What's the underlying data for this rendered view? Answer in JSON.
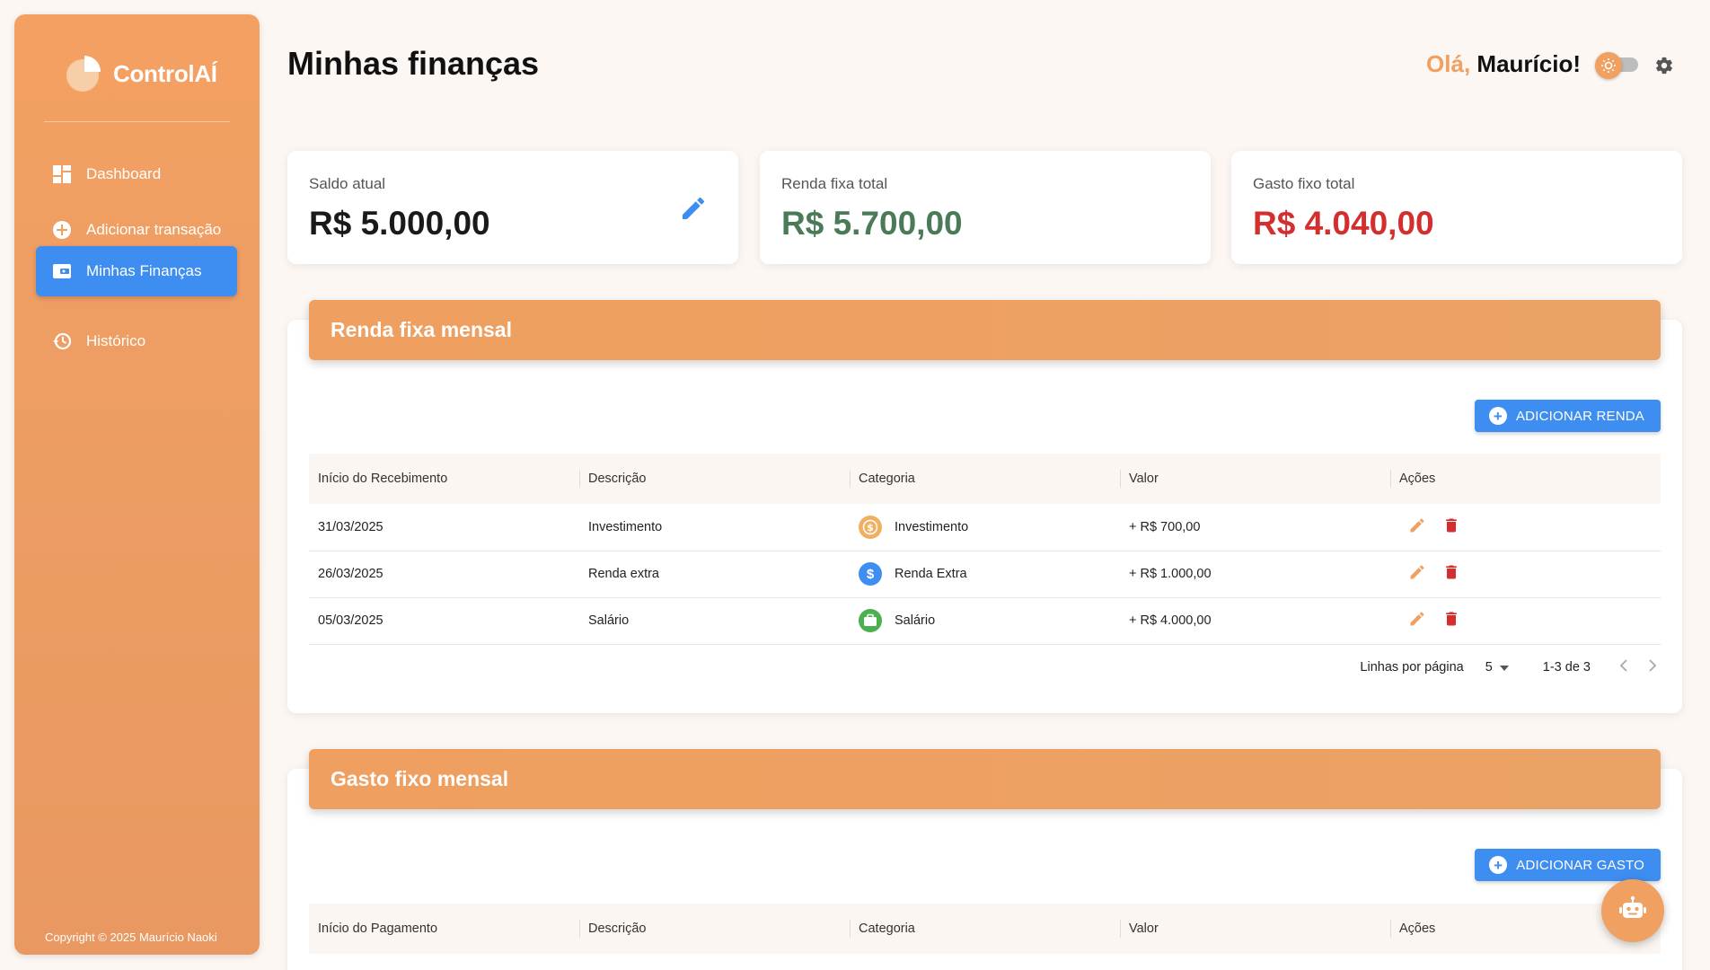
{
  "app": {
    "name": "ControlAÍ",
    "copyright": "Copyright © 2025 Maurício Naoki"
  },
  "sidebar": {
    "items": [
      {
        "label": "Dashboard",
        "icon": "dashboard-icon",
        "active": false
      },
      {
        "label": "Adicionar transação",
        "icon": "add-circle-icon",
        "active": false
      },
      {
        "label": "Minhas Finanças",
        "icon": "wallet-icon",
        "active": true
      },
      {
        "label": "Histórico",
        "icon": "history-icon",
        "active": false
      }
    ]
  },
  "header": {
    "title": "Minhas finanças",
    "greeting_prefix": "Olá,",
    "greeting_name": "Maurício!"
  },
  "cards": [
    {
      "label": "Saldo atual",
      "value": "R$ 5.000,00",
      "color": "#1a1a1a"
    },
    {
      "label": "Renda fixa total",
      "value": "R$ 5.700,00",
      "color": "#4a7a57"
    },
    {
      "label": "Gasto fixo total",
      "value": "R$ 4.040,00",
      "color": "#d32f2f"
    }
  ],
  "income": {
    "title": "Renda fixa mensal",
    "add_label": "ADICIONAR RENDA",
    "columns": [
      "Início do Recebimento",
      "Descrição",
      "Categoria",
      "Valor",
      "Ações"
    ],
    "rows": [
      {
        "date": "31/03/2025",
        "description": "Investimento",
        "category": "Investimento",
        "category_icon": "coin-icon",
        "category_color": "#f0b060",
        "value": "+ R$ 700,00"
      },
      {
        "date": "26/03/2025",
        "description": "Renda extra",
        "category": "Renda Extra",
        "category_icon": "dollar-icon",
        "category_color": "#3d8ef0",
        "value": "+ R$ 1.000,00"
      },
      {
        "date": "05/03/2025",
        "description": "Salário",
        "category": "Salário",
        "category_icon": "briefcase-icon",
        "category_color": "#4caf50",
        "value": "+ R$ 4.000,00"
      }
    ],
    "rows_per_page_label": "Linhas por página",
    "rows_per_page": "5",
    "range": "1-3 de 3"
  },
  "expense": {
    "title": "Gasto fixo mensal",
    "add_label": "ADICIONAR GASTO",
    "columns": [
      "Início do Pagamento",
      "Descrição",
      "Categoria",
      "Valor",
      "Ações"
    ]
  },
  "colors": {
    "accent": "#f0a060",
    "primary": "#3d8ef0",
    "edit": "#f0a060",
    "delete": "#d32f2f"
  }
}
